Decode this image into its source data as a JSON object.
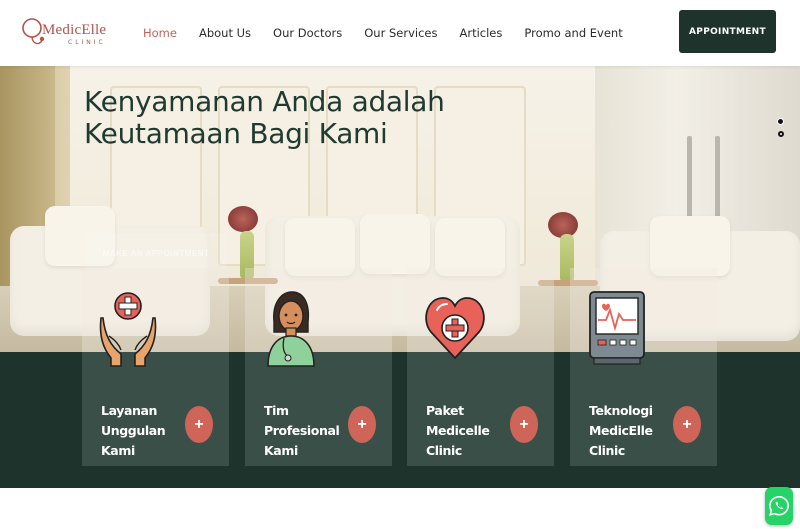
{
  "logo": {
    "name": "MedicElle",
    "subtitle": "CLINIC"
  },
  "nav": {
    "items": [
      {
        "label": "Home",
        "active": true
      },
      {
        "label": "About Us",
        "active": false
      },
      {
        "label": "Our Doctors",
        "active": false
      },
      {
        "label": "Our Services",
        "active": false
      },
      {
        "label": "Articles",
        "active": false
      },
      {
        "label": "Promo and Event",
        "active": false
      }
    ]
  },
  "header": {
    "appointment_label": "APPOINTMENT"
  },
  "hero": {
    "title_line1": "Kenyamanan Anda adalah",
    "title_line2": "Keutamaan Bagi Kami",
    "cta_label": "MAKE AN APPOINTMENT",
    "slider_dots": 2,
    "active_slide": 1
  },
  "cards": [
    {
      "line1": "Layanan",
      "line2": "Unggulan Kami",
      "icon": "care-hands-icon",
      "button": "+"
    },
    {
      "line1": "Tim Profesional",
      "line2": "Kami",
      "icon": "doctor-avatar-icon",
      "button": "+"
    },
    {
      "line1": "Paket Medicelle",
      "line2": "Clinic",
      "icon": "heart-medical-icon",
      "button": "+"
    },
    {
      "line1": "Teknologi",
      "line2": "MedicElle Clinic",
      "icon": "heart-monitor-icon",
      "button": "+"
    }
  ],
  "colors": {
    "brand": "#b5524a",
    "dark_green": "#1f332d",
    "card_bg": "#3b4f49",
    "accent_button": "#cf6458",
    "whatsapp": "#25d366"
  },
  "whatsapp": {
    "icon": "whatsapp-icon"
  }
}
